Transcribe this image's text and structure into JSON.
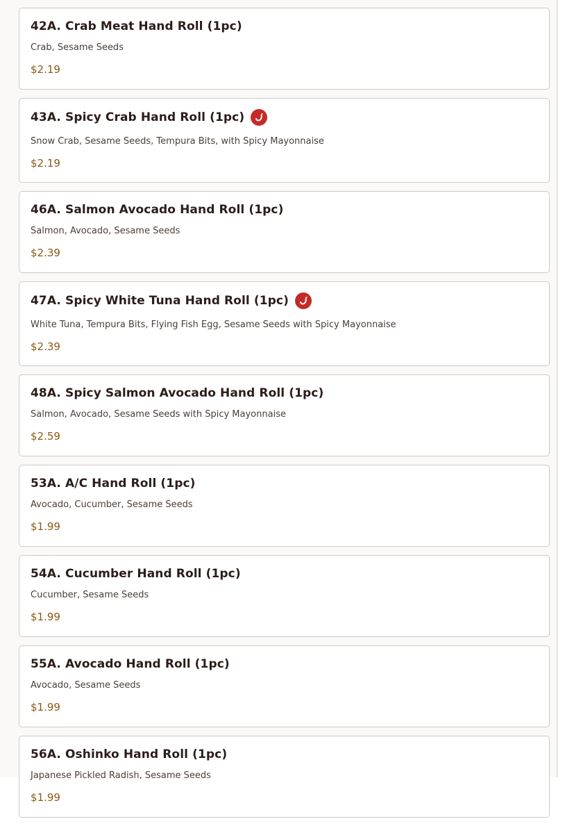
{
  "menu": {
    "items": [
      {
        "title": "42A. Crab Meat Hand Roll (1pc)",
        "description": "Crab, Sesame Seeds",
        "price": "$2.19",
        "spicy": false
      },
      {
        "title": "43A. Spicy Crab Hand Roll (1pc)",
        "description": "Snow Crab, Sesame Seeds, Tempura Bits, with Spicy Mayonnaise",
        "price": "$2.19",
        "spicy": true
      },
      {
        "title": "46A. Salmon Avocado Hand Roll (1pc)",
        "description": "Salmon, Avocado, Sesame Seeds",
        "price": "$2.39",
        "spicy": false
      },
      {
        "title": "47A. Spicy White Tuna Hand Roll (1pc)",
        "description": "White Tuna, Tempura Bits, Flying Fish Egg, Sesame Seeds with Spicy Mayonnaise",
        "price": "$2.39",
        "spicy": true
      },
      {
        "title": "48A. Spicy Salmon Avocado Hand Roll (1pc)",
        "description": "Salmon, Avocado, Sesame Seeds with Spicy Mayonnaise",
        "price": "$2.59",
        "spicy": false
      },
      {
        "title": "53A. A/C Hand Roll (1pc)",
        "description": "Avocado, Cucumber, Sesame Seeds",
        "price": "$1.99",
        "spicy": false
      },
      {
        "title": "54A. Cucumber Hand Roll (1pc)",
        "description": "Cucumber, Sesame Seeds",
        "price": "$1.99",
        "spicy": false
      },
      {
        "title": "55A. Avocado Hand Roll (1pc)",
        "description": "Avocado, Sesame Seeds",
        "price": "$1.99",
        "spicy": false
      },
      {
        "title": "56A. Oshinko Hand Roll (1pc)",
        "description": "Japanese Pickled Radish, Sesame Seeds",
        "price": "$1.99",
        "spicy": false
      }
    ]
  },
  "icons": {
    "spicy": "chili-pepper-icon"
  },
  "colors": {
    "spicy_badge": "#c42b27",
    "price": "#8a5a14",
    "title": "#2b1d1a"
  }
}
